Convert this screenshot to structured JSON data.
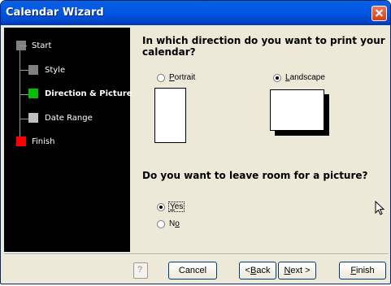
{
  "window": {
    "title": "Calendar Wizard"
  },
  "steps": [
    {
      "label": "Start",
      "color": "#808080",
      "current": false
    },
    {
      "label": "Style",
      "color": "#808080",
      "current": false
    },
    {
      "label": "Direction & Picture",
      "color": "#00c000",
      "current": true
    },
    {
      "label": "Date Range",
      "color": "#c0c0c0",
      "current": false
    },
    {
      "label": "Finish",
      "color": "#ff0000",
      "current": false
    }
  ],
  "direction": {
    "question_line1": "In which direction do you want to print your",
    "question_line2": "calendar?",
    "portrait": {
      "mnemonic": "P",
      "rest": "ortrait",
      "selected": false
    },
    "landscape": {
      "mnemonic": "L",
      "rest": "andscape",
      "selected": true
    }
  },
  "picture": {
    "question": "Do you want to leave room for a picture?",
    "yes": {
      "mnemonic": "Y",
      "rest": "es",
      "selected": true
    },
    "no": {
      "prefix": "N",
      "mnemonic": "o",
      "selected": false
    }
  },
  "buttons": {
    "cancel": "Cancel",
    "back": {
      "prefix": "< ",
      "mnemonic": "B",
      "rest": "ack"
    },
    "next": {
      "mnemonic": "N",
      "rest": "ext >"
    },
    "finish": {
      "mnemonic": "F",
      "rest": "inish"
    }
  }
}
